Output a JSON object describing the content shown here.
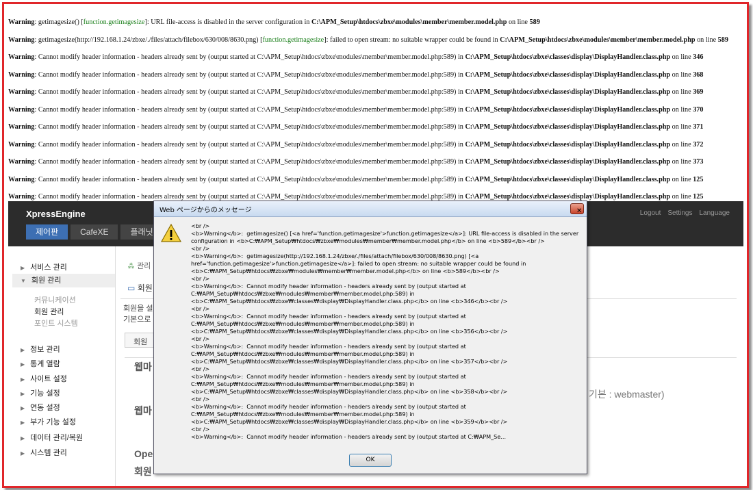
{
  "warnings": [
    {
      "label": "Warning",
      "parts": [
        {
          "t": ": getimagesize() ["
        },
        {
          "t": "function.getimagesize",
          "c": "fn"
        },
        {
          "t": "]: URL file-access is disabled in the server configuration in "
        },
        {
          "t": "C:\\APM_Setup\\htdocs\\zbxe\\modules\\member\\member.model.php",
          "b": true
        },
        {
          "t": " on line "
        },
        {
          "t": "589",
          "b": true
        }
      ]
    },
    {
      "label": "Warning",
      "parts": [
        {
          "t": ": getimagesize(http://192.168.1.24/zbxe/./files/attach/filebox/630/008/8630.png) ["
        },
        {
          "t": "function.getimagesize",
          "c": "fn"
        },
        {
          "t": "]: failed to open stream: no suitable wrapper could be found in "
        },
        {
          "t": "C:\\APM_Setup\\htdocs\\zbxe\\modules\\member\\member.model.php",
          "b": true
        },
        {
          "t": " on line "
        },
        {
          "t": "589",
          "b": true
        }
      ]
    },
    {
      "label": "Warning",
      "parts": [
        {
          "t": ": Cannot modify header information - headers already sent by (output started at C:\\APM_Setup\\htdocs\\zbxe\\modules\\member\\member.model.php:589) in "
        },
        {
          "t": "C:\\APM_Setup\\htdocs\\zbxe\\classes\\display\\DisplayHandler.class.php",
          "b": true
        },
        {
          "t": " on line "
        },
        {
          "t": "346",
          "b": true
        }
      ]
    },
    {
      "label": "Warning",
      "parts": [
        {
          "t": ": Cannot modify header information - headers already sent by (output started at C:\\APM_Setup\\htdocs\\zbxe\\modules\\member\\member.model.php:589) in "
        },
        {
          "t": "C:\\APM_Setup\\htdocs\\zbxe\\classes\\display\\DisplayHandler.class.php",
          "b": true
        },
        {
          "t": " on line "
        },
        {
          "t": "368",
          "b": true
        }
      ]
    },
    {
      "label": "Warning",
      "parts": [
        {
          "t": ": Cannot modify header information - headers already sent by (output started at C:\\APM_Setup\\htdocs\\zbxe\\modules\\member\\member.model.php:589) in "
        },
        {
          "t": "C:\\APM_Setup\\htdocs\\zbxe\\classes\\display\\DisplayHandler.class.php",
          "b": true
        },
        {
          "t": " on line "
        },
        {
          "t": "369",
          "b": true
        }
      ]
    },
    {
      "label": "Warning",
      "parts": [
        {
          "t": ": Cannot modify header information - headers already sent by (output started at C:\\APM_Setup\\htdocs\\zbxe\\modules\\member\\member.model.php:589) in "
        },
        {
          "t": "C:\\APM_Setup\\htdocs\\zbxe\\classes\\display\\DisplayHandler.class.php",
          "b": true
        },
        {
          "t": " on line "
        },
        {
          "t": "370",
          "b": true
        }
      ]
    },
    {
      "label": "Warning",
      "parts": [
        {
          "t": ": Cannot modify header information - headers already sent by (output started at C:\\APM_Setup\\htdocs\\zbxe\\modules\\member\\member.model.php:589) in "
        },
        {
          "t": "C:\\APM_Setup\\htdocs\\zbxe\\classes\\display\\DisplayHandler.class.php",
          "b": true
        },
        {
          "t": " on line "
        },
        {
          "t": "371",
          "b": true
        }
      ]
    },
    {
      "label": "Warning",
      "parts": [
        {
          "t": ": Cannot modify header information - headers already sent by (output started at C:\\APM_Setup\\htdocs\\zbxe\\modules\\member\\member.model.php:589) in "
        },
        {
          "t": "C:\\APM_Setup\\htdocs\\zbxe\\classes\\display\\DisplayHandler.class.php",
          "b": true
        },
        {
          "t": " on line "
        },
        {
          "t": "372",
          "b": true
        }
      ]
    },
    {
      "label": "Warning",
      "parts": [
        {
          "t": ": Cannot modify header information - headers already sent by (output started at C:\\APM_Setup\\htdocs\\zbxe\\modules\\member\\member.model.php:589) in "
        },
        {
          "t": "C:\\APM_Setup\\htdocs\\zbxe\\classes\\display\\DisplayHandler.class.php",
          "b": true
        },
        {
          "t": " on line "
        },
        {
          "t": "373",
          "b": true
        }
      ]
    },
    {
      "label": "Warning",
      "parts": [
        {
          "t": ": Cannot modify header information - headers already sent by (output started at C:\\APM_Setup\\htdocs\\zbxe\\modules\\member\\member.model.php:589) in "
        },
        {
          "t": "C:\\APM_Setup\\htdocs\\zbxe\\classes\\display\\DisplayHandler.class.php",
          "b": true
        },
        {
          "t": " on line "
        },
        {
          "t": "125",
          "b": true
        }
      ]
    },
    {
      "label": "Warning",
      "parts": [
        {
          "t": ": Cannot modify header information - headers already sent by (output started at C:\\APM_Setup\\htdocs\\zbxe\\modules\\member\\member.model.php:589) in "
        },
        {
          "t": "C:\\APM_Setup\\htdocs\\zbxe\\classes\\display\\DisplayHandler.class.php",
          "b": true
        },
        {
          "t": " on line "
        },
        {
          "t": "125",
          "b": true
        }
      ]
    }
  ],
  "xe": {
    "logo": "XpressEngine",
    "tabs": [
      "제어판",
      "CafeXE",
      "플래닛"
    ],
    "utils": [
      "Logout",
      "Settings",
      "Language"
    ],
    "sidebar": {
      "items": [
        "서비스 관리",
        "회원 관리",
        "정보 관리",
        "통계 열람",
        "사이트 설정",
        "기능 설정",
        "연동 설정",
        "부가 기능 설정",
        "데이터 관리/복원",
        "시스템 관리"
      ],
      "subitems": [
        "커뮤니케이션",
        "회원 관리",
        "포인트 시스템"
      ]
    },
    "content": {
      "breadcrumb": "관리",
      "title": "회원",
      "desc1": "회원을 설",
      "desc2": "기본으로",
      "tab1": "회원",
      "row1": "웹마",
      "row2": "웹마",
      "default_hint": "기본 : webmaster)",
      "open_head": "Ope",
      "member_head": "회원"
    }
  },
  "dialog": {
    "title": "Web ページからのメッセージ",
    "close": "✕",
    "icon": "warning-icon",
    "message": "<br />\n<b>Warning</b>:  getimagesize() [<a href='function.getimagesize'>function.getimagesize</a>]: URL file-access is disabled in the server\nconfiguration in <b>C:₩APM_Setup₩htdocs₩zbxe₩modules₩member₩member.model.php</b> on line <b>589</b><br />\n<br />\n<b>Warning</b>:  getimagesize(http://192.168.1.24/zbxe/./files/attach/filebox/630/008/8630.png) [<a\nhref='function.getimagesize'>function.getimagesize</a>]: failed to open stream: no suitable wrapper could be found in\n<b>C:₩APM_Setup₩htdocs₩zbxe₩modules₩member₩member.model.php</b> on line <b>589</b><br />\n<br />\n<b>Warning</b>:  Cannot modify header information - headers already sent by (output started at\nC:₩APM_Setup₩htdocs₩zbxe₩modules₩member₩member.model.php:589) in\n<b>C:₩APM_Setup₩htdocs₩zbxe₩classes₩display₩DisplayHandler.class.php</b> on line <b>346</b><br />\n<br />\n<b>Warning</b>:  Cannot modify header information - headers already sent by (output started at\nC:₩APM_Setup₩htdocs₩zbxe₩modules₩member₩member.model.php:589) in\n<b>C:₩APM_Setup₩htdocs₩zbxe₩classes₩display₩DisplayHandler.class.php</b> on line <b>356</b><br />\n<br />\n<b>Warning</b>:  Cannot modify header information - headers already sent by (output started at\nC:₩APM_Setup₩htdocs₩zbxe₩modules₩member₩member.model.php:589) in\n<b>C:₩APM_Setup₩htdocs₩zbxe₩classes₩display₩DisplayHandler.class.php</b> on line <b>357</b><br />\n<br />\n<b>Warning</b>:  Cannot modify header information - headers already sent by (output started at\nC:₩APM_Setup₩htdocs₩zbxe₩modules₩member₩member.model.php:589) in\n<b>C:₩APM_Setup₩htdocs₩zbxe₩classes₩display₩DisplayHandler.class.php</b> on line <b>358</b><br />\n<br />\n<b>Warning</b>:  Cannot modify header information - headers already sent by (output started at\nC:₩APM_Setup₩htdocs₩zbxe₩modules₩member₩member.model.php:589) in\n<b>C:₩APM_Setup₩htdocs₩zbxe₩classes₩display₩DisplayHandler.class.php</b> on line <b>359</b><br />\n<br />\n<b>Warning</b>:  Cannot modify header information - headers already sent by (output started at C:₩APM_Se...",
    "ok_label": "OK"
  },
  "colors": {
    "frame": "#e0262a",
    "fn_link": "#1a7f1a",
    "xe_tab_active": "#3d6fb3"
  }
}
